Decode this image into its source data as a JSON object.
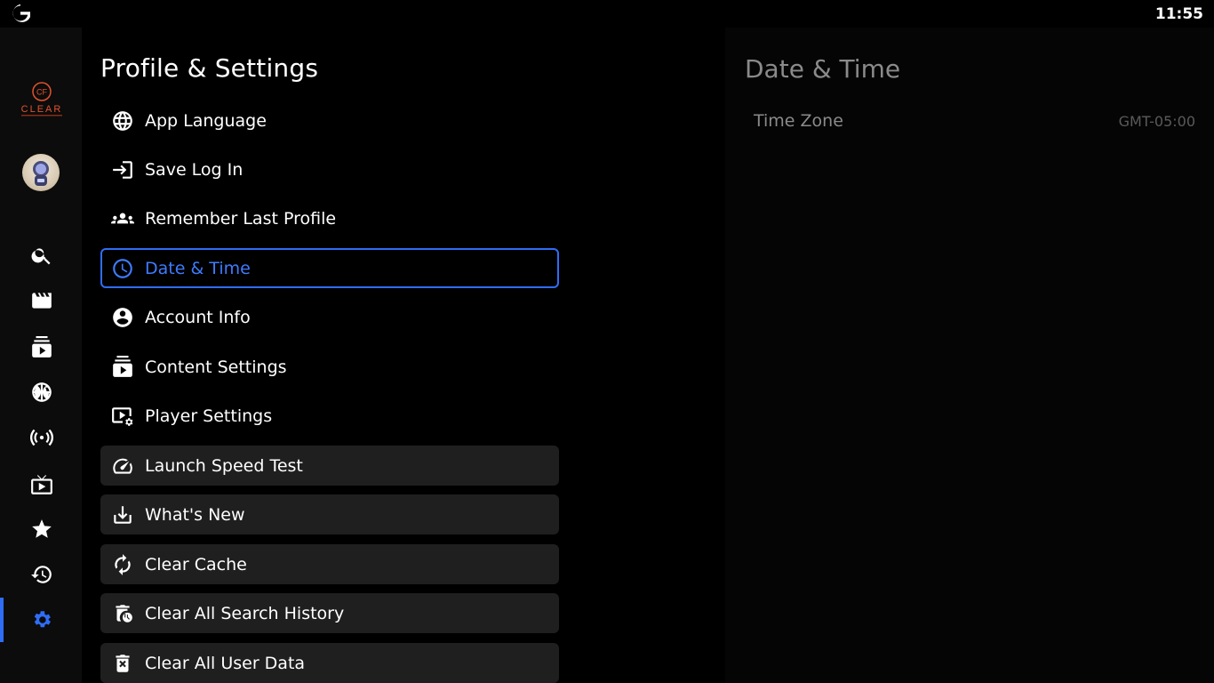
{
  "status_bar": {
    "time": "11:55"
  },
  "brand": {
    "badge": "CF",
    "name": "CLEAR"
  },
  "rail": {
    "items": [
      {
        "icon": "search-icon"
      },
      {
        "icon": "movie-icon"
      },
      {
        "icon": "series-icon"
      },
      {
        "icon": "sports-icon"
      },
      {
        "icon": "live-broadcast-icon"
      },
      {
        "icon": "tv-icon"
      },
      {
        "icon": "star-icon"
      },
      {
        "icon": "history-icon"
      },
      {
        "icon": "settings-icon",
        "active": true
      }
    ],
    "accent": "#2f6df6"
  },
  "settings": {
    "title": "Profile & Settings",
    "items": [
      {
        "label": "App Language",
        "icon": "globe-icon"
      },
      {
        "label": "Save Log In",
        "icon": "login-icon"
      },
      {
        "label": "Remember Last Profile",
        "icon": "group-icon"
      },
      {
        "label": "Date & Time",
        "icon": "clock-icon",
        "active": true
      },
      {
        "label": "Account Info",
        "icon": "account-icon"
      },
      {
        "label": "Content Settings",
        "icon": "content-icon"
      },
      {
        "label": "Player Settings",
        "icon": "player-settings-icon"
      },
      {
        "label": "Launch Speed Test",
        "icon": "speedometer-icon"
      },
      {
        "label": "What's New",
        "icon": "download-icon"
      },
      {
        "label": "Clear Cache",
        "icon": "refresh-icon"
      },
      {
        "label": "Clear All Search History",
        "icon": "delete-history-icon"
      },
      {
        "label": "Clear All User Data",
        "icon": "delete-icon"
      }
    ]
  },
  "detail": {
    "title": "Date & Time",
    "time_zone_label": "Time Zone",
    "time_zone_value": "GMT-05:00"
  }
}
